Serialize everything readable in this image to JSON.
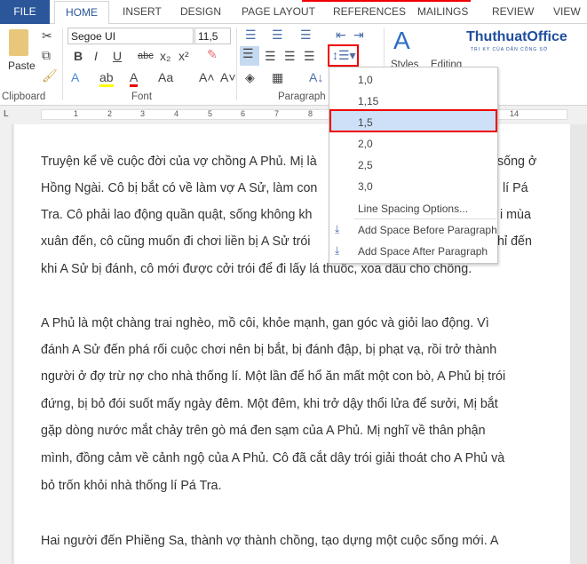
{
  "tabs": {
    "file": "FILE",
    "home": "HOME",
    "insert": "INSERT",
    "design": "DESIGN",
    "page_layout": "PAGE LAYOUT",
    "references": "REFERENCES",
    "mailings": "MAILINGS",
    "review": "REVIEW",
    "view": "VIEW"
  },
  "logo": {
    "name": "ThuthuatOffice",
    "tagline": "TRI KỲ CỦA DÂN CÔNG SỞ"
  },
  "ribbon": {
    "paste": "Paste",
    "font_name": "Segoe UI",
    "font_size": "11,5",
    "groups": {
      "clipboard": "Clipboard",
      "font": "Font",
      "paragraph": "Paragraph"
    },
    "styles": "Styles",
    "editing": "Editing"
  },
  "colors": {
    "accent": "#2b579a",
    "highlight": "#e00000",
    "selected": "#cde0f7"
  },
  "menu": {
    "items": [
      "1,0",
      "1,15",
      "1,5",
      "2,0",
      "2,5",
      "3,0"
    ],
    "selected": "1,5",
    "options": "Line Spacing Options...",
    "before": "Add Space Before Paragraph",
    "after": "Add Space After Paragraph"
  },
  "ruler": {
    "marks": [
      "1",
      "2",
      "3",
      "4",
      "5",
      "6",
      "7",
      "8",
      "14"
    ]
  },
  "document": {
    "lines": [
      "Truyện kể về cuộc đời của vợ chồng A Phủ. Mị là",
      "Hồng Ngài. Cô bị bắt có về làm vợ A Sử, làm con",
      "Tra. Cô phải lao động quần quật, sống không kh",
      "xuân đến, cô cũng muốn đi chơi liền bị A Sử trói",
      "khi A Sử bị đánh, cô mới được cởi trói để đi lấy lá thuốc, xoa dầu cho chồng.",
      "A Phủ là một chàng trai nghèo, mồ côi, khỏe mạnh, gan góc và giỏi lao động. Vì",
      "đánh A Sử đến phá rối cuộc chơi nên bị bắt, bị đánh đập, bị phạt vạ, rồi trở thành",
      "người ở đợ trừ nợ cho nhà thống lí. Một lần để hổ ăn mất một con bò, A Phủ bị trói",
      "đứng, bị bỏ đói suốt mấy ngày đêm. Một đêm, khi trở dậy thổi lửa để sưởi, Mị bắt",
      "gặp dòng nước mắt chảy trên gò má đen sạm của A Phủ. Mị nghĩ về thân phận",
      "mình, đồng cảm về cảnh ngộ của A Phủ. Cô đã cắt dây trói giải thoát cho A Phủ và",
      "bỏ trốn khỏi nhà thống lí Pá Tra.",
      "Hai người đến Phiềng Sa, thành vợ thành chồng, tạo dựng một cuộc sống mới. A"
    ],
    "right_fragments": [
      "sống ở",
      "lí Pá",
      "i mùa",
      "hỉ đến"
    ]
  }
}
